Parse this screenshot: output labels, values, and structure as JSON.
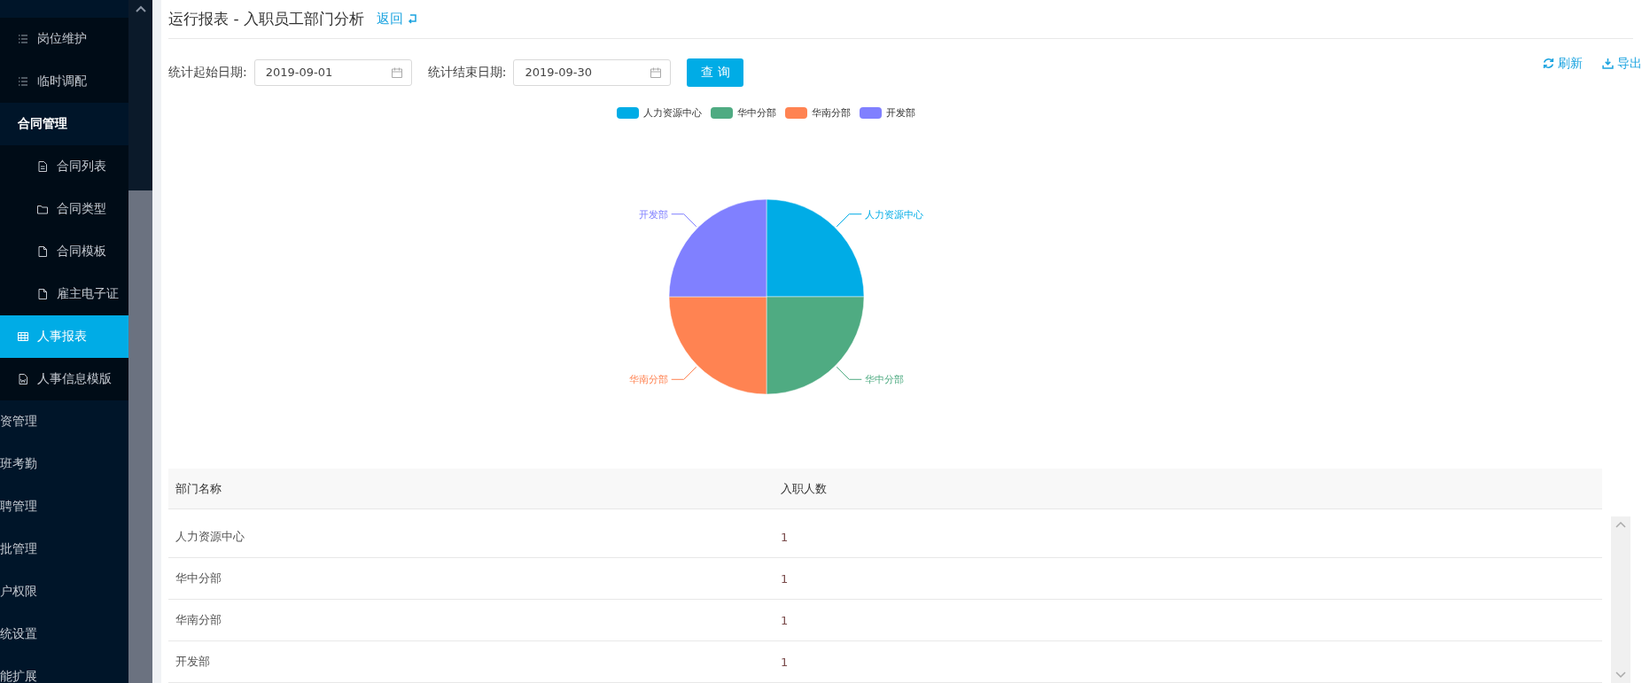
{
  "sidebar": {
    "items": [
      {
        "label": "岗位维护",
        "kind": "list",
        "selected": false
      },
      {
        "label": "临时调配",
        "kind": "list",
        "selected": false
      },
      {
        "label": "合同管理",
        "kind": "group",
        "selected": false,
        "expanded": true,
        "children": [
          {
            "label": "合同列表",
            "kind": "doc",
            "selected": false
          },
          {
            "label": "合同类型",
            "kind": "folder",
            "selected": false
          },
          {
            "label": "合同模板",
            "kind": "file",
            "selected": false
          },
          {
            "label": "雇主电子证",
            "kind": "file",
            "selected": false
          }
        ]
      },
      {
        "label": "人事报表",
        "kind": "table",
        "selected": true
      },
      {
        "label": "人事信息模版",
        "kind": "word",
        "selected": false
      },
      {
        "label": "资管理",
        "kind": "top",
        "selected": false
      },
      {
        "label": "班考勤",
        "kind": "top",
        "selected": false
      },
      {
        "label": "聘管理",
        "kind": "top",
        "selected": false
      },
      {
        "label": "批管理",
        "kind": "top",
        "selected": false
      },
      {
        "label": "户权限",
        "kind": "top",
        "selected": false
      },
      {
        "label": "统设置",
        "kind": "top",
        "selected": false
      },
      {
        "label": "能扩展",
        "kind": "top",
        "selected": false
      }
    ]
  },
  "page": {
    "title": "运行报表 - 入职员工部门分析",
    "back_link": "返回"
  },
  "filters": [
    {
      "label": "统计起始日期:",
      "value": "2019-09-01"
    },
    {
      "label": "统计结束日期:",
      "value": "2019-09-30"
    }
  ],
  "query_button": "查 询",
  "actions": [
    {
      "label": "刷新",
      "kind": "refresh"
    },
    {
      "label": "导出",
      "kind": "download"
    }
  ],
  "legend": [
    {
      "label": "人力资源中心",
      "color": "#00ace6"
    },
    {
      "label": "华中分部",
      "color": "#4fab82"
    },
    {
      "label": "华南分部",
      "color": "#ff8352"
    },
    {
      "label": "开发部",
      "color": "#8080ff"
    }
  ],
  "chart": {
    "chart_data": {
      "type": "pie",
      "categories": [
        "人力资源中心",
        "华中分部",
        "华南分部",
        "开发部"
      ],
      "values": [
        25,
        25,
        25,
        25
      ]
    }
  },
  "table": {
    "columns": [
      "部门名称",
      "入职人数"
    ],
    "rows": [
      [
        "人力资源中心",
        "1"
      ],
      [
        "华中分部",
        "1"
      ],
      [
        "华南分部",
        "1"
      ],
      [
        "开发部",
        "1"
      ]
    ]
  }
}
